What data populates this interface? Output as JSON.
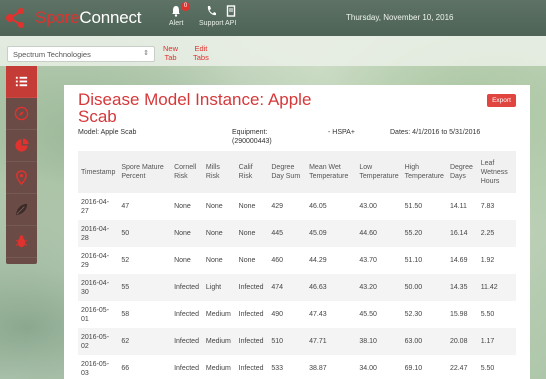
{
  "app": {
    "brand_part1": "Spore",
    "brand_part2": "Connect",
    "date": "Thursday, November 10, 2016"
  },
  "nav": [
    {
      "label": "Alert",
      "icon": "bell-icon",
      "badge": "0"
    },
    {
      "label": "Support",
      "icon": "phone-icon"
    },
    {
      "label": "API",
      "icon": "document-icon"
    }
  ],
  "subbar": {
    "company": "Spectrum Technologies",
    "new_tab": [
      "New",
      "Tab"
    ],
    "edit_tabs": [
      "Edit",
      "Tabs"
    ]
  },
  "sidebar": {
    "icons": [
      "list-icon",
      "compass-icon",
      "pie-chart-icon",
      "map-pin-icon",
      "leaf-icon",
      "bug-icon"
    ]
  },
  "page": {
    "title": "Disease Model Instance: Apple Scab",
    "export_label": "Export",
    "model": "Model: Apple Scab",
    "equipment_label": "Equipment:",
    "equipment_id": "(290000443)",
    "equipment_type": "- HSPA+",
    "dates": "Dates: 4/1/2016 to 5/31/2016"
  },
  "table": {
    "headers": [
      "Timestamp",
      "Spore Mature Percent",
      "Cornell Risk",
      "Mills Risk",
      "Calif Risk",
      "Degree Day Sum",
      "Mean Wet Temperature",
      "Low Temperature",
      "High Temperature",
      "Degree Days",
      "Leaf Wetness Hours"
    ],
    "rows": [
      [
        "2016-04-27",
        "47",
        "None",
        "None",
        "None",
        "429",
        "46.05",
        "43.00",
        "51.50",
        "14.11",
        "7.83"
      ],
      [
        "2016-04-28",
        "50",
        "None",
        "None",
        "None",
        "445",
        "45.09",
        "44.60",
        "55.20",
        "16.14",
        "2.25"
      ],
      [
        "2016-04-29",
        "52",
        "None",
        "None",
        "None",
        "460",
        "44.29",
        "43.70",
        "51.10",
        "14.69",
        "1.92"
      ],
      [
        "2016-04-30",
        "55",
        "Infected",
        "Light",
        "Infected",
        "474",
        "46.63",
        "43.20",
        "50.00",
        "14.35",
        "11.42"
      ],
      [
        "2016-05-01",
        "58",
        "Infected",
        "Medium",
        "Infected",
        "490",
        "47.43",
        "45.50",
        "52.30",
        "15.98",
        "5.50"
      ],
      [
        "2016-05-02",
        "62",
        "Infected",
        "Medium",
        "Infected",
        "510",
        "47.71",
        "38.10",
        "63.00",
        "20.08",
        "1.17"
      ],
      [
        "2016-05-03",
        "66",
        "Infected",
        "Medium",
        "Infected",
        "533",
        "38.87",
        "34.00",
        "69.10",
        "22.47",
        "5.50"
      ]
    ]
  }
}
